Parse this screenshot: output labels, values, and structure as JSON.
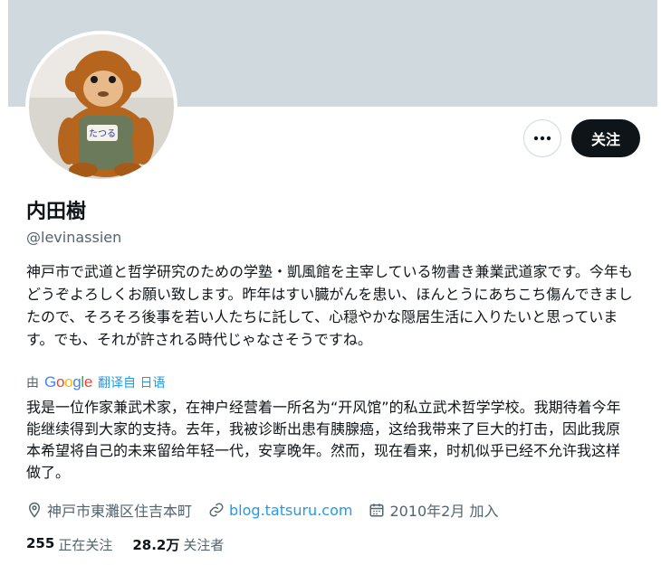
{
  "profile": {
    "name": "内田樹",
    "handle": "@levinassien",
    "bio": "神戸市で武道と哲学研究のための学塾・凱風館を主宰している物書き兼業武道家です。今年もどうぞよろしくお願い致します。昨年はすい臓がんを患い、ほんとうにあちこち傷んできましたので、そろそろ後事を若い人たちに託して、心穏やかな隠居生活に入りたいと思っています。でも、それが許される時代じゃなさそうですね。",
    "translation": {
      "by": "由",
      "provider": "Google",
      "link": "翻译自 日语",
      "text": "我是一位作家兼武术家，在神户经营着一所名为“开风馆”的私立武术哲学学校。我期待着今年能继续得到大家的支持。去年，我被诊断出患有胰腺癌，这给我带来了巨大的打击，因此我原本希望将自己的未来留给年轻一代，安享晚年。然而，现在看来，时机似乎已经不允许我这样做了。"
    },
    "location": "神戸市東灘区住吉本町",
    "website": "blog.tatsuru.com",
    "joined": "2010年2月 加入",
    "following_count": "255",
    "following_label": "正在关注",
    "followers_count": "28.2万",
    "followers_label": "关注者"
  },
  "actions": {
    "follow_label": "关注",
    "more_icon": "more-dots-icon"
  },
  "colors": {
    "banner": "#cfd9de",
    "accent": "#1d9bf0",
    "text": "#0f1419",
    "secondary": "#536471"
  }
}
